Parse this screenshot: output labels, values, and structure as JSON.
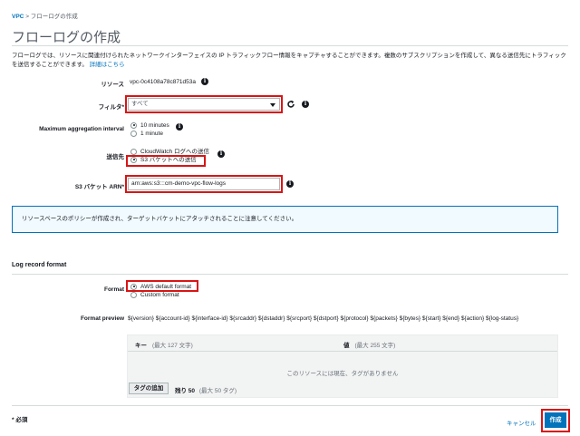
{
  "breadcrumb": {
    "parent": "VPC",
    "separator": ">",
    "current": "フローログの作成"
  },
  "page_title": "フローログの作成",
  "description": "フローログでは、リソースに関連付けられたネットワークインターフェイスの IP トラフィックフロー情報をキャプチャすることができます。複数のサブスクリプションを作成して、異なる送信先にトラフィックを送信することができます。",
  "description_link": "詳細はこちら",
  "resource": {
    "label": "リソース",
    "value": "vpc-0c4108a78c871d53a"
  },
  "filter": {
    "label": "フィルタ*",
    "selected": "すべて"
  },
  "aggregation": {
    "label": "Maximum aggregation interval",
    "options": [
      "10 minutes",
      "1 minute"
    ],
    "selected_index": 0
  },
  "destination": {
    "label": "送信先",
    "options": [
      "CloudWatch ログへの送信",
      "S3 バケットへの送信"
    ],
    "selected_index": 1
  },
  "s3_arn": {
    "label": "S3 バケット ARN*",
    "value": "arn:aws:s3:::cm-demo-vpc-flow-logs"
  },
  "notice": "リソースベースのポリシーが作成され、ターゲットバケットにアタッチされることに注意してください。",
  "log_record_format": {
    "heading": "Log record format"
  },
  "format": {
    "label": "Format",
    "options": [
      "AWS default format",
      "Custom format"
    ],
    "selected_index": 0
  },
  "format_preview": {
    "label": "Format preview",
    "value": "${version} ${account-id} ${interface-id} ${srcaddr} ${dstaddr} ${srcport} ${dstport} ${protocol} ${packets} ${bytes} ${start} ${end} ${action} ${log-status}"
  },
  "tags": {
    "key_header": "キー",
    "key_limit": "(最大 127 文字)",
    "value_header": "値",
    "value_limit": "(最大 255 文字)",
    "empty": "このリソースには現在、タグがありません",
    "add_button": "タグの追加",
    "remaining": "残り 50",
    "remaining_limit": "(最大 50 タグ)"
  },
  "footer": {
    "required_note": "* 必須",
    "cancel": "キャンセル",
    "create": "作成"
  },
  "colors": {
    "accent": "#0073bb",
    "highlight": "#d91515"
  }
}
